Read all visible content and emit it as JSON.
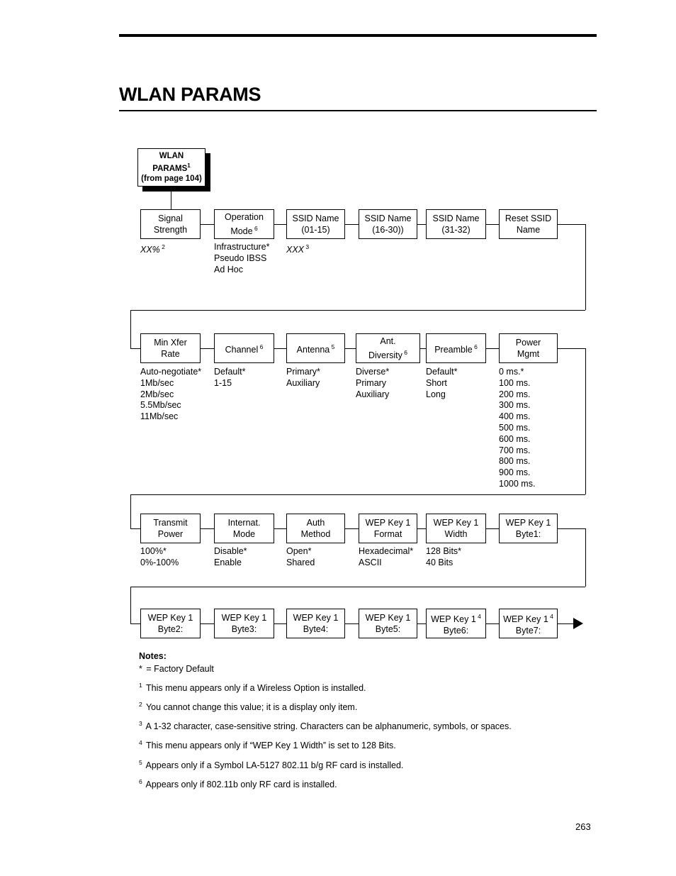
{
  "page": {
    "title": "WLAN PARAMS",
    "number": "263"
  },
  "root": {
    "line1": "WLAN",
    "line2": "PARAMS",
    "line2_sup": "1",
    "line3": "(from page 104)"
  },
  "rows": [
    {
      "nodes": [
        {
          "line1": "Signal",
          "line2": "Strength"
        },
        {
          "line1": "Operation",
          "line2": "Mode",
          "line2_sup": "6"
        },
        {
          "line1": "SSID Name",
          "line2": "(01-15)"
        },
        {
          "line1": "SSID Name",
          "line2": "(16-30))"
        },
        {
          "line1": "SSID Name",
          "line2": "(31-32)"
        },
        {
          "line1": "Reset SSID",
          "line2": "Name"
        }
      ],
      "options": [
        {
          "items": [
            {
              "text": "XX%",
              "italic": true,
              "sup": "2"
            }
          ]
        },
        {
          "items": [
            {
              "text": "Infrastructure*"
            },
            {
              "text": "Pseudo IBSS"
            },
            {
              "text": "Ad Hoc"
            }
          ]
        },
        {
          "items": [
            {
              "text": "XXX",
              "italic": true,
              "sup": "3"
            }
          ]
        },
        {
          "items": []
        },
        {
          "items": []
        },
        {
          "items": []
        }
      ]
    },
    {
      "nodes": [
        {
          "line1": "Min Xfer",
          "line2": "Rate"
        },
        {
          "line1": "Channel",
          "line1_sup": "6"
        },
        {
          "line1": "Antenna",
          "line1_sup": "5"
        },
        {
          "line1": "Ant.",
          "line2": "Diversity",
          "line2_sup": "6"
        },
        {
          "line1": "Preamble",
          "line1_sup": "6"
        },
        {
          "line1": "Power",
          "line2": "Mgmt"
        }
      ],
      "options": [
        {
          "items": [
            {
              "text": "Auto-negotiate*"
            },
            {
              "text": "1Mb/sec"
            },
            {
              "text": "2Mb/sec"
            },
            {
              "text": "5.5Mb/sec"
            },
            {
              "text": "11Mb/sec"
            }
          ]
        },
        {
          "items": [
            {
              "text": "Default*"
            },
            {
              "text": "1-15"
            }
          ]
        },
        {
          "items": [
            {
              "text": "Primary*"
            },
            {
              "text": "Auxiliary"
            }
          ]
        },
        {
          "items": [
            {
              "text": "Diverse*"
            },
            {
              "text": "Primary"
            },
            {
              "text": "Auxiliary"
            }
          ]
        },
        {
          "items": [
            {
              "text": "Default*"
            },
            {
              "text": "Short"
            },
            {
              "text": "Long"
            }
          ]
        },
        {
          "items": [
            {
              "text": "0 ms.*"
            },
            {
              "text": "100 ms."
            },
            {
              "text": "200 ms."
            },
            {
              "text": "300 ms."
            },
            {
              "text": "400 ms."
            },
            {
              "text": "500 ms."
            },
            {
              "text": "600 ms."
            },
            {
              "text": "700 ms."
            },
            {
              "text": "800 ms."
            },
            {
              "text": "900 ms."
            },
            {
              "text": "1000 ms."
            }
          ]
        }
      ]
    },
    {
      "nodes": [
        {
          "line1": "Transmit",
          "line2": "Power"
        },
        {
          "line1": "Internat.",
          "line2": "Mode"
        },
        {
          "line1": "Auth",
          "line2": "Method"
        },
        {
          "line1": "WEP Key 1",
          "line2": "Format"
        },
        {
          "line1": "WEP Key 1",
          "line2": "Width"
        },
        {
          "line1": "WEP Key 1",
          "line2": "Byte1:"
        }
      ],
      "options": [
        {
          "items": [
            {
              "text": "100%*"
            },
            {
              "text": "0%-100%"
            }
          ]
        },
        {
          "items": [
            {
              "text": "Disable*"
            },
            {
              "text": "Enable"
            }
          ]
        },
        {
          "items": [
            {
              "text": "Open*"
            },
            {
              "text": "Shared"
            }
          ]
        },
        {
          "items": [
            {
              "text": "Hexadecimal*"
            },
            {
              "text": "ASCII"
            }
          ]
        },
        {
          "items": [
            {
              "text": "128 Bits*"
            },
            {
              "text": "40 Bits"
            }
          ]
        },
        {
          "items": []
        }
      ]
    },
    {
      "nodes": [
        {
          "line1": "WEP Key 1",
          "line2": "Byte2:"
        },
        {
          "line1": "WEP Key 1",
          "line2": "Byte3:"
        },
        {
          "line1": "WEP Key 1",
          "line2": "Byte4:"
        },
        {
          "line1": "WEP Key 1",
          "line2": "Byte5:"
        },
        {
          "line1": "WEP Key 1",
          "line1_sup": "4",
          "line2": "Byte6:"
        },
        {
          "line1": "WEP Key 1",
          "line1_sup": "4",
          "line2": "Byte7:"
        }
      ],
      "options": [
        {
          "items": []
        },
        {
          "items": []
        },
        {
          "items": []
        },
        {
          "items": []
        },
        {
          "items": []
        },
        {
          "items": []
        }
      ]
    }
  ],
  "notes": {
    "heading": "Notes:",
    "items": [
      {
        "mark": "*",
        "is_star": true,
        "text": "= Factory Default"
      },
      {
        "mark": "1",
        "text": "This menu appears only if a Wireless Option is installed."
      },
      {
        "mark": "2",
        "text": "You cannot change this value; it is a display only item."
      },
      {
        "mark": "3",
        "text": "A 1-32 character, case-sensitive string. Characters can be alphanumeric, symbols, or spaces."
      },
      {
        "mark": "4",
        "text": "This menu appears only if “WEP Key 1 Width” is set to 128 Bits."
      },
      {
        "mark": "5",
        "text": "Appears only if a Symbol LA-5127 802.11 b/g RF card is installed."
      },
      {
        "mark": "6",
        "text": "Appears only if 802.11b only RF card is installed."
      }
    ]
  }
}
